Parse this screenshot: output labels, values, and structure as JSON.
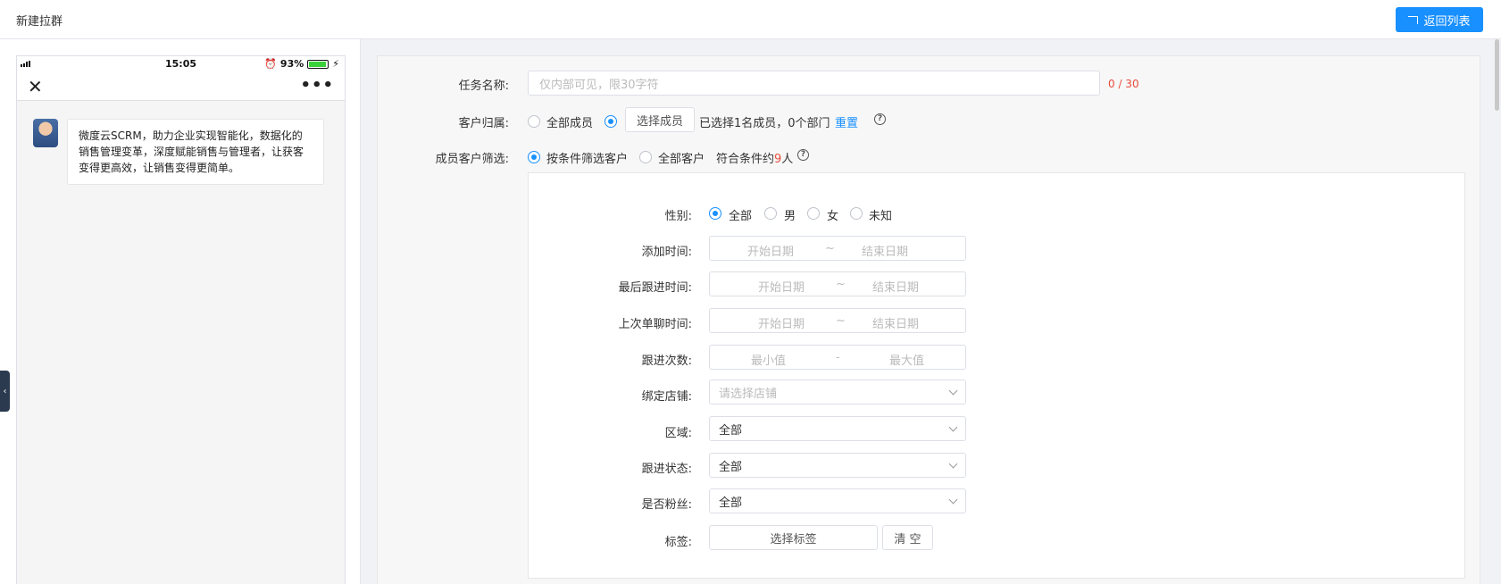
{
  "header": {
    "title": "新建拉群",
    "back_label": "返回列表"
  },
  "phone": {
    "time": "15:05",
    "battery": "93%",
    "battery_level": 0.93,
    "message": "微度云SCRM，助力企业实现智能化，数据化的销售管理变革，深度赋能销售与管理者，让获客变得更高效，让销售变得更简单。"
  },
  "form": {
    "task_name": {
      "label": "任务名称:",
      "placeholder": "仅内部可见，限30字符",
      "counter": "0 / 30"
    },
    "owner": {
      "label": "客户归属:",
      "option_all": "全部成员",
      "select_btn": "选择成员",
      "selected_info": "已选择1名成员，0个部门",
      "reset": "重置"
    },
    "filter": {
      "label": "成员客户筛选:",
      "option_condition": "按条件筛选客户",
      "option_all": "全部客户",
      "match_prefix": "符合条件约",
      "match_count": "9",
      "match_suffix": "人"
    },
    "gender": {
      "label": "性别:",
      "options": [
        "全部",
        "男",
        "女",
        "未知"
      ]
    },
    "add_time": {
      "label": "添加时间:",
      "start": "开始日期",
      "sep": "~",
      "end": "结束日期"
    },
    "last_follow": {
      "label": "最后跟进时间:",
      "start": "开始日期",
      "sep": "~",
      "end": "结束日期"
    },
    "last_chat": {
      "label": "上次单聊时间:",
      "start": "开始日期",
      "sep": "~",
      "end": "结束日期"
    },
    "follow_count": {
      "label": "跟进次数:",
      "min": "最小值",
      "sep": "-",
      "max": "最大值"
    },
    "store": {
      "label": "绑定店铺:",
      "placeholder": "请选择店铺"
    },
    "region": {
      "label": "区域:",
      "value": "全部"
    },
    "follow_status": {
      "label": "跟进状态:",
      "value": "全部"
    },
    "is_fan": {
      "label": "是否粉丝:",
      "value": "全部"
    },
    "tags": {
      "label": "标签:",
      "select_btn": "选择标签",
      "clear_btn": "清 空"
    }
  }
}
